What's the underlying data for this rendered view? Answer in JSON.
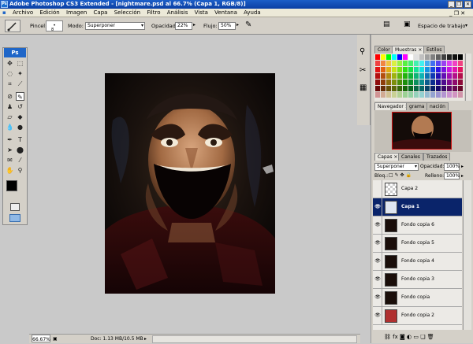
{
  "window": {
    "title": "Adobe Photoshop CS3 Extended - [nightmare.psd al 66.7% (Capa 1, RGB/8)]",
    "controls": [
      "_",
      "❐",
      "✕"
    ]
  },
  "menu": [
    "Archivo",
    "Edición",
    "Imagen",
    "Capa",
    "Selección",
    "Filtro",
    "Análisis",
    "Vista",
    "Ventana",
    "Ayuda"
  ],
  "options": {
    "brush_label": "Pincel:",
    "brush_size": "8",
    "mode_label": "Modo:",
    "mode_value": "Superponer",
    "opacity_label": "Opacidad:",
    "opacity_value": "22%",
    "flow_label": "Flujo:",
    "flow_value": "50%",
    "workspace_label": "Espacio de trabajo"
  },
  "toolbox": {
    "logo": "Ps"
  },
  "status": {
    "zoom": "66.67%",
    "doc": "Doc: 1.13 MB/10.5 MB"
  },
  "color_panel": {
    "tabs": [
      "Color",
      "Muestras",
      "Estilos"
    ],
    "active_tab": "Muestras"
  },
  "navigator_panel": {
    "tabs": [
      "Navegador",
      "grama",
      "nación"
    ]
  },
  "layers_panel": {
    "tabs": [
      "Capas",
      "Canales",
      "Trazados"
    ],
    "blend_mode": "Superponer",
    "opacity_label": "Opacidad:",
    "opacity_value": "100%",
    "lock_label": "Bloq.:",
    "fill_label": "Relleno:",
    "fill_value": "100%",
    "layers": [
      {
        "name": "Capa 2",
        "visible": false,
        "selected": false
      },
      {
        "name": "Capa 1",
        "visible": true,
        "selected": true
      },
      {
        "name": "Fondo copia 6",
        "visible": true,
        "selected": false
      },
      {
        "name": "Fondo copia 5",
        "visible": true,
        "selected": false
      },
      {
        "name": "Fondo copia 4",
        "visible": true,
        "selected": false
      },
      {
        "name": "Fondo copia 3",
        "visible": true,
        "selected": false
      },
      {
        "name": "Fondo copia",
        "visible": true,
        "selected": false
      },
      {
        "name": "Fondo copia 2",
        "visible": true,
        "selected": false
      }
    ]
  },
  "colors": {
    "title_bar": "#0b3fa3",
    "selection": "#0a246a",
    "accent": "#1f66c8"
  }
}
